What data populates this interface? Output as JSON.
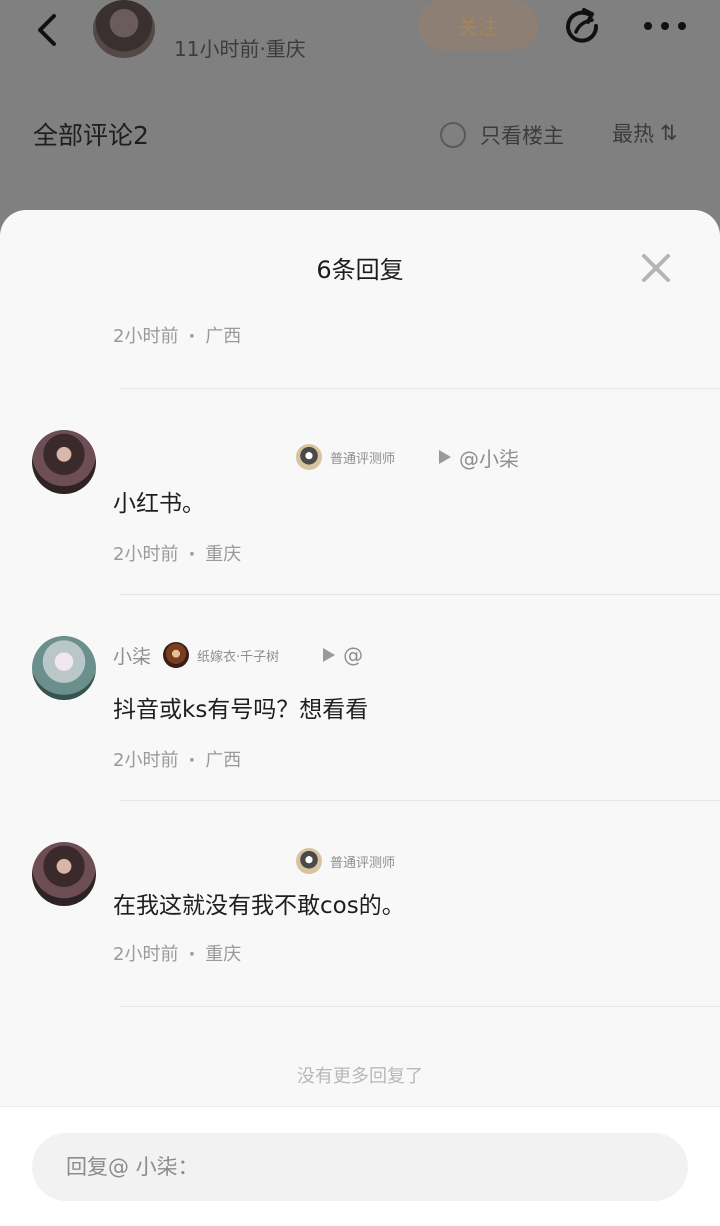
{
  "header": {
    "post_meta": "11小时前·重庆",
    "follow_label": "关注"
  },
  "comments_bar": {
    "title": "全部评论2",
    "op_only_label": "只看楼主",
    "sort_label": "最热",
    "sort_icon": "⇅"
  },
  "sheet": {
    "title": "6条回复",
    "top_meta": {
      "time": "2小时前",
      "location": "广西"
    },
    "replies": [
      {
        "name": "",
        "badge": "普通评测师",
        "mention": "@小柒",
        "text": "小红书。",
        "time": "2小时前",
        "location": "重庆"
      },
      {
        "name": "小柒",
        "badge": "纸嫁衣·千子树",
        "mention": "@",
        "text": "抖音或ks有号吗？想看看",
        "time": "2小时前",
        "location": "广西"
      },
      {
        "name": "",
        "badge": "普通评测师",
        "mention": "",
        "text": "在我这就没有我不敢cos的。",
        "time": "2小时前",
        "location": "重庆"
      }
    ],
    "no_more": "没有更多回复了"
  },
  "input": {
    "placeholder": "回复@ 小柒："
  }
}
